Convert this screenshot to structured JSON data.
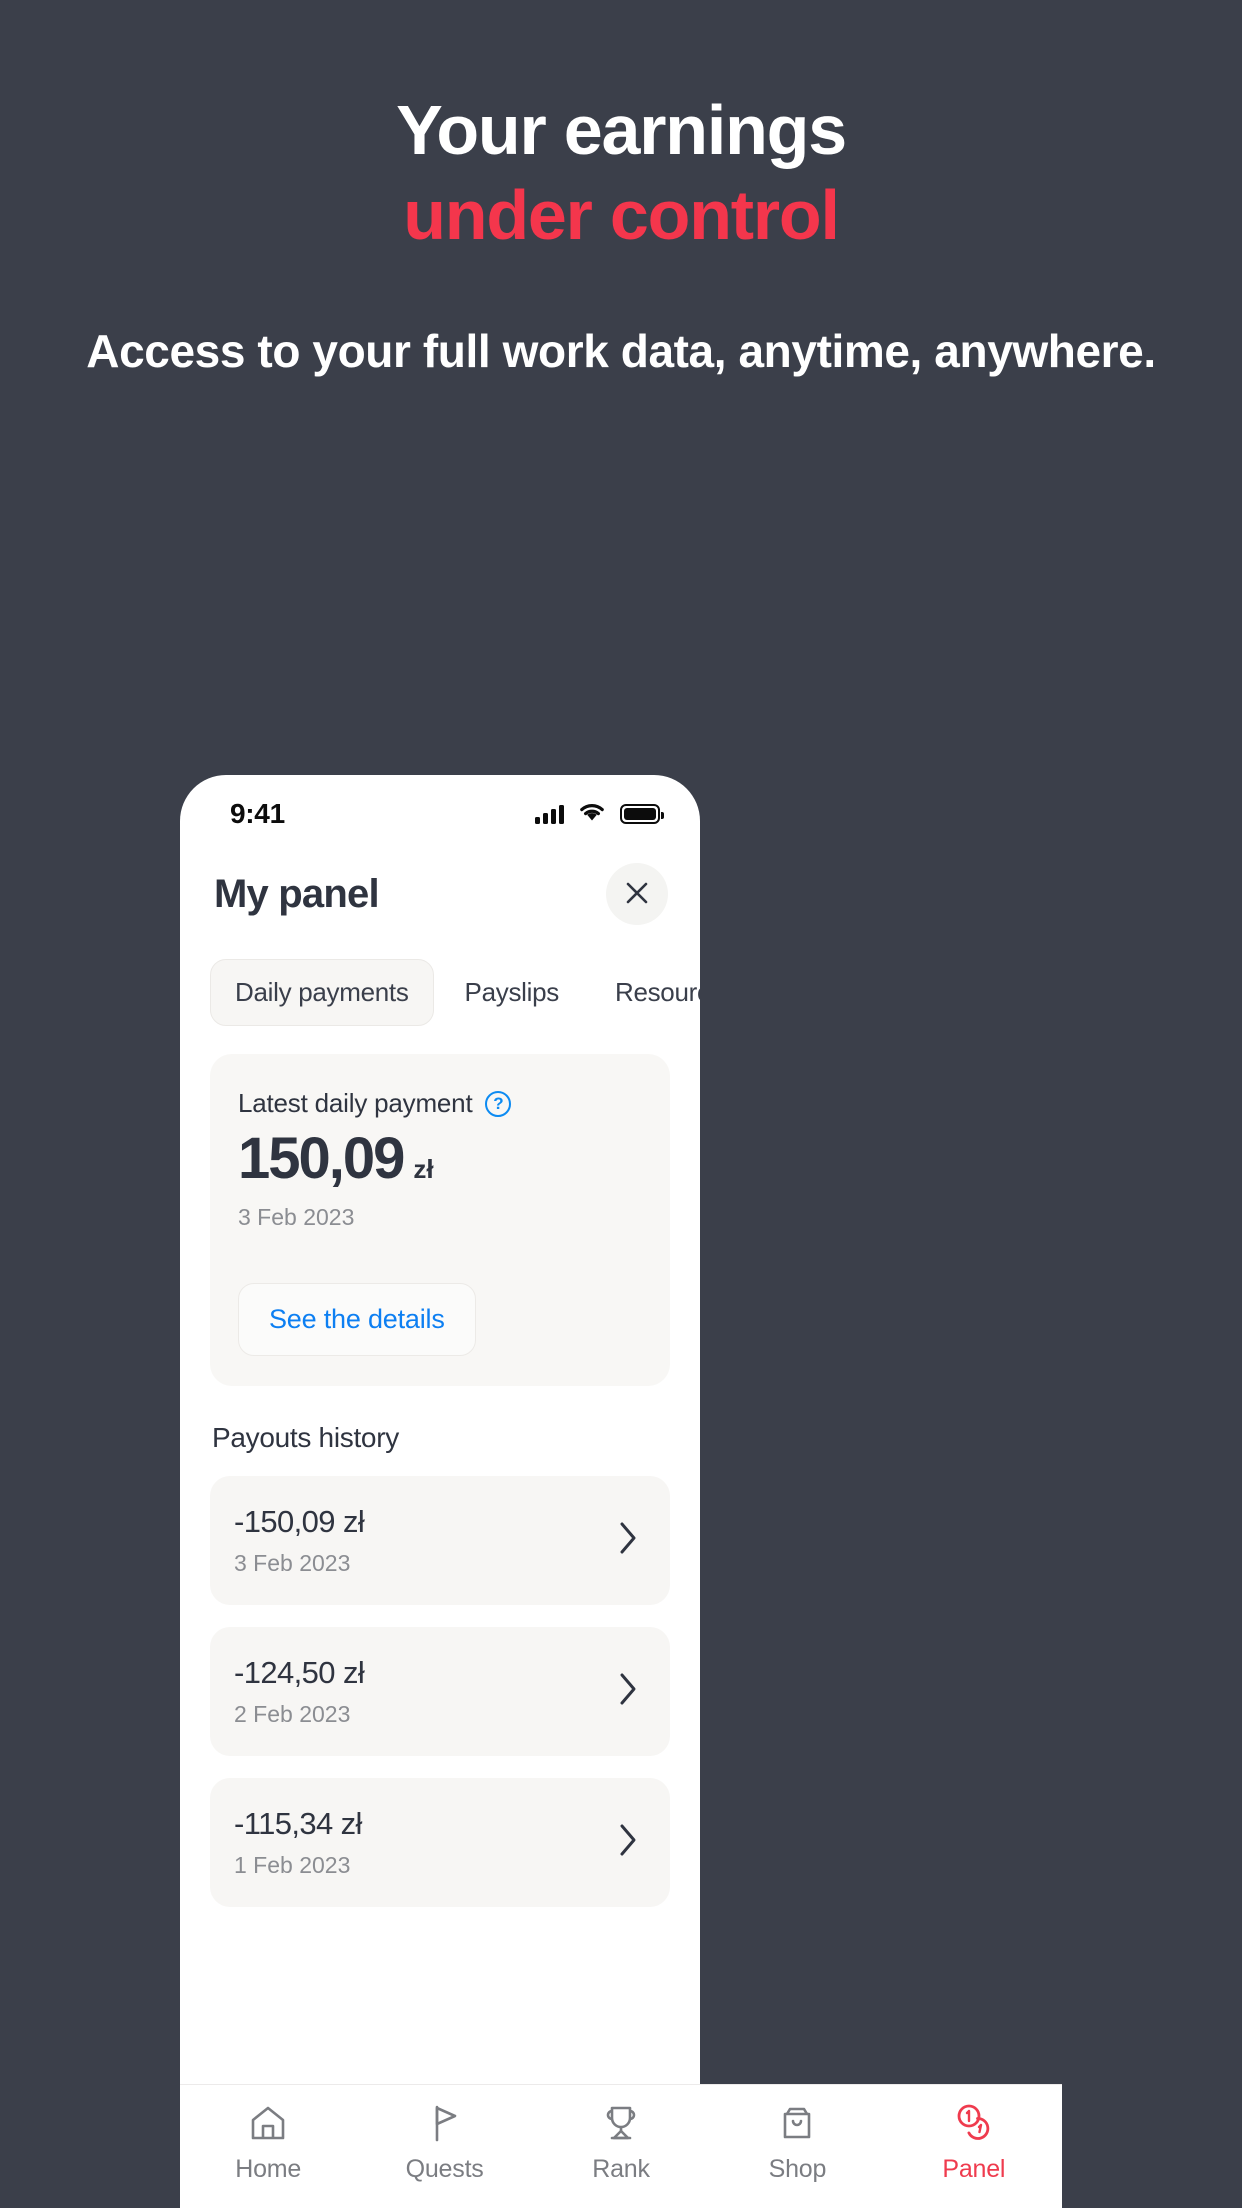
{
  "promo": {
    "headline_line1": "Your earnings",
    "headline_line2": "under control",
    "subheadline": "Access to your full work data, anytime, anywhere.",
    "accent_color": "#f4364c",
    "background_color": "#3b3f4a"
  },
  "status_bar": {
    "time": "9:41",
    "signal_icon": "signal-bars-icon",
    "wifi_icon": "wifi-icon",
    "battery_icon": "battery-full-icon"
  },
  "app": {
    "title": "My panel",
    "close_icon": "close-icon",
    "tabs": [
      {
        "label": "Daily payments",
        "active": true
      },
      {
        "label": "Payslips",
        "active": false
      },
      {
        "label": "Resources",
        "active": false
      }
    ],
    "latest_card": {
      "title": "Latest daily payment",
      "help_icon": "question-mark-icon",
      "amount": "150,09",
      "currency": "zł",
      "date": "3 Feb 2023",
      "details_button": "See the details",
      "link_color": "#0d7ff2"
    },
    "history": {
      "title": "Payouts history",
      "rows": [
        {
          "amount": "-150,09 zł",
          "date": "3 Feb 2023",
          "chevron": "chevron-right-icon"
        },
        {
          "amount": "-124,50 zł",
          "date": "2 Feb 2023",
          "chevron": "chevron-right-icon"
        },
        {
          "amount": "-115,34 zł",
          "date": "1 Feb 2023",
          "chevron": "chevron-right-icon"
        }
      ]
    },
    "bottom_nav": {
      "items": [
        {
          "label": "Home",
          "icon": "home-icon",
          "active": false
        },
        {
          "label": "Quests",
          "icon": "flag-icon",
          "active": false
        },
        {
          "label": "Rank",
          "icon": "trophy-icon",
          "active": false
        },
        {
          "label": "Shop",
          "icon": "bag-icon",
          "active": false
        },
        {
          "label": "Panel",
          "icon": "coins-icon",
          "active": true
        }
      ],
      "active_color": "#ef3b4e",
      "inactive_color": "#7b7d82"
    }
  }
}
